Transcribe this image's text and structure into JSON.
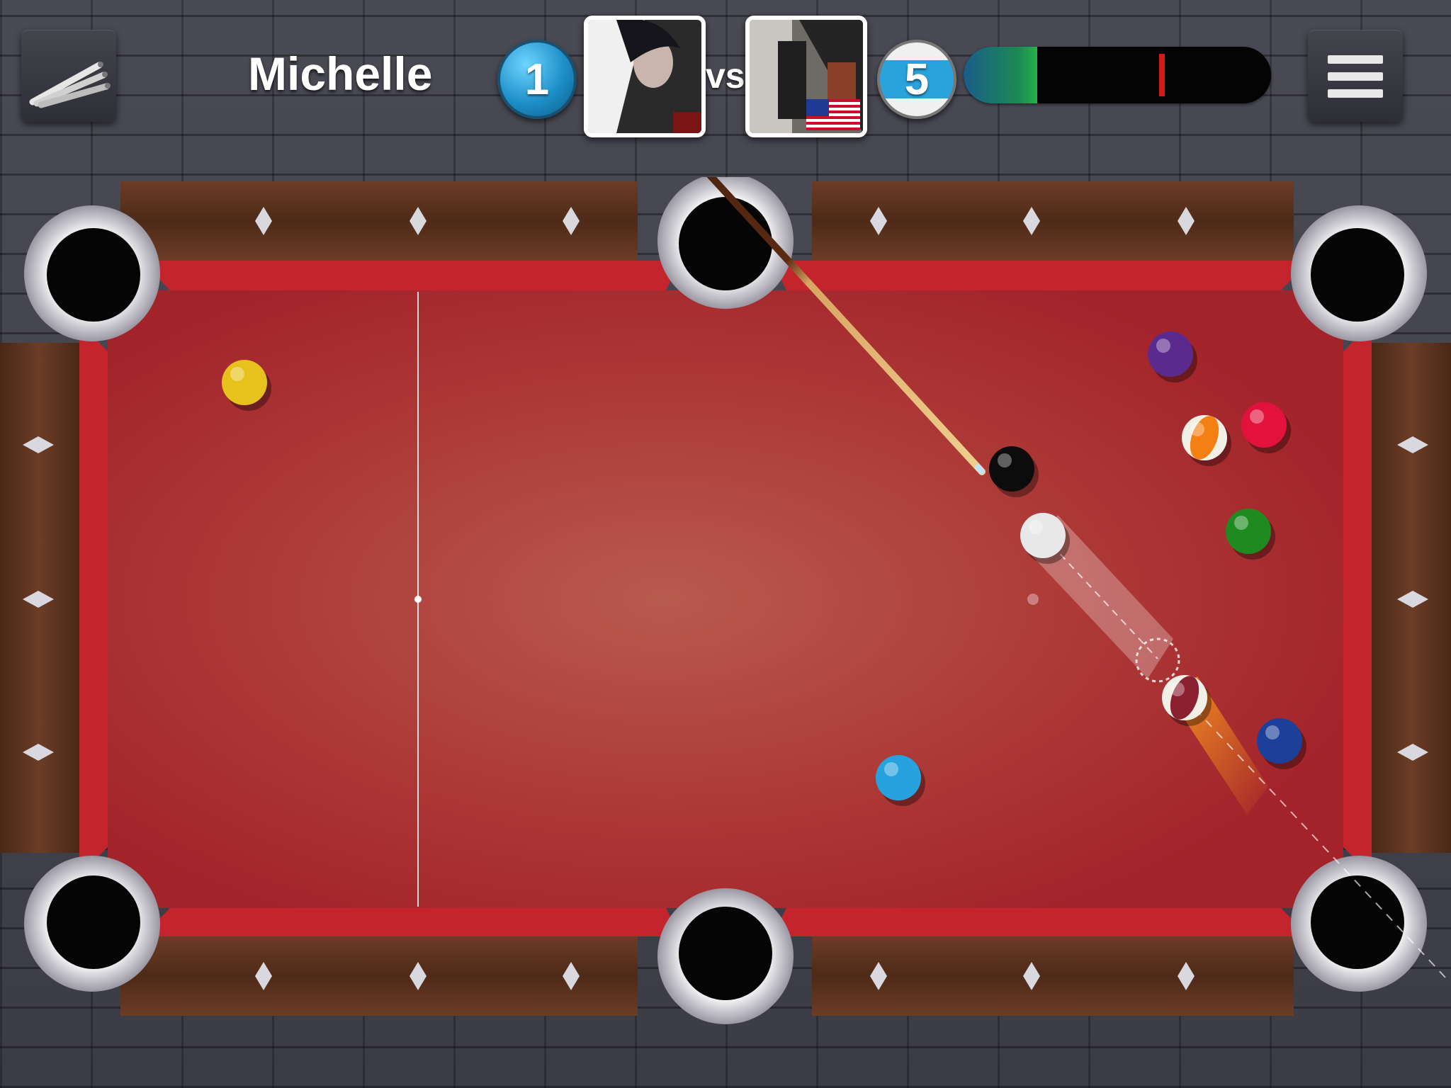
{
  "hud": {
    "player_name": "Michelle",
    "player_ball_number": "1",
    "versus_label": "vs",
    "opponent_ball_number": "5",
    "opponent_country_flag": "us-flag-icon",
    "shot_power_fraction": 0.24
  },
  "menu": {
    "icon": "hamburger-menu-icon"
  },
  "cue_selector": {
    "icon": "cue-sticks-icon"
  },
  "table": {
    "felt_color": "#a8232a",
    "rail_wood_color": "#5a3220",
    "balls": [
      {
        "id": "yellow",
        "color": "#e8c21c",
        "striped": false
      },
      {
        "id": "purple",
        "color": "#5b2a8e",
        "striped": false
      },
      {
        "id": "red",
        "color": "#e2123c",
        "striped": false
      },
      {
        "id": "orange-stripe",
        "color": "#f47f12",
        "striped": true
      },
      {
        "id": "green",
        "color": "#1f8a1f",
        "striped": false
      },
      {
        "id": "black",
        "color": "#0c0c0c",
        "striped": false
      },
      {
        "id": "cue-ball",
        "color": "#e8e8e8",
        "striped": false
      },
      {
        "id": "maroon-stripe",
        "color": "#8a2030",
        "striped": true
      },
      {
        "id": "blue",
        "color": "#1c3f9a",
        "striped": false
      },
      {
        "id": "light-blue",
        "color": "#27a2de",
        "striped": false
      }
    ]
  }
}
